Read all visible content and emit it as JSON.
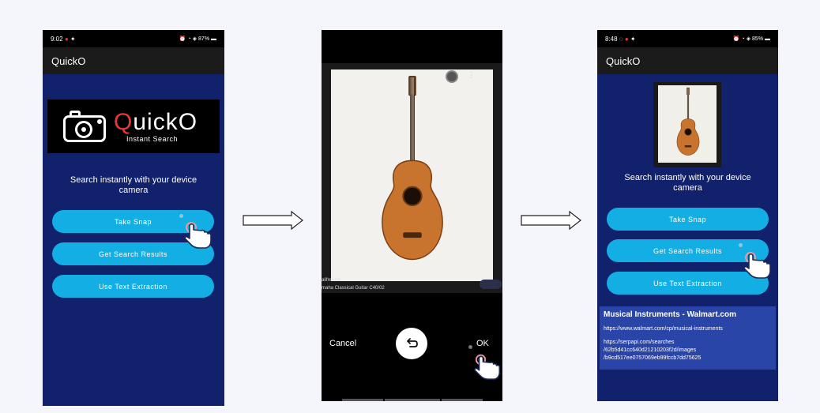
{
  "screen1": {
    "status": {
      "time": "9:02",
      "net_left": "ᵒᵗ₄ₗ",
      "battery": "87%"
    },
    "app_title": "QuickO",
    "logo": {
      "brand_first": "Q",
      "brand_rest": "uickO",
      "tagline": "Instant Search"
    },
    "tagline": "Search instantly with your device camera",
    "buttons": [
      "Take Snap",
      "Get Search Results",
      "Use Text Extraction"
    ]
  },
  "screen2": {
    "caption_source": "alifreezin",
    "caption_title": "maha Classical Guitar C40/02",
    "cancel_label": "Cancel",
    "ok_label": "OK"
  },
  "screen3": {
    "status": {
      "time": "8:48",
      "battery": "85%"
    },
    "app_title": "QuickO",
    "tagline": "Search instantly with your device camera",
    "buttons": [
      "Take Snap",
      "Get Search Results",
      "Use Text Extraction"
    ],
    "result": {
      "title": "Musical Instruments - Walmart.com",
      "url": "https://www.walmart.com/cp/musical-instruments",
      "link_line1": "https://serpapi.com/searches",
      "link_line2": "/62b5d41cc640d21210203f2d/images",
      "link_line3": "/b9cd517ee0757069eb99fccb7dd75625"
    }
  },
  "colors": {
    "app_bg": "#11216b",
    "button": "#13aee4",
    "result_bg": "#2a45a8",
    "logo_accent": "#e53935"
  }
}
